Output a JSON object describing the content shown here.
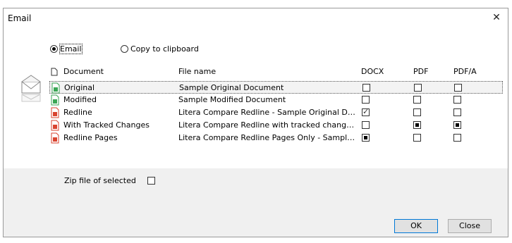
{
  "window": {
    "title": "Email",
    "close_glyph": "✕"
  },
  "mode": {
    "options": [
      {
        "label": "Email",
        "selected": true
      },
      {
        "label": "Copy to clipboard",
        "selected": false
      }
    ]
  },
  "table": {
    "headers": {
      "document": "Document",
      "file_name": "File name",
      "docx": "DOCX",
      "pdf": "PDF",
      "pdfa": "PDF/A"
    },
    "rows": [
      {
        "document": "Original",
        "file_name": "Sample Original Document",
        "docx": "unchecked",
        "pdf": "unchecked",
        "pdfa": "unchecked",
        "selected": true
      },
      {
        "document": "Modified",
        "file_name": "Sample Modified Document",
        "docx": "unchecked",
        "pdf": "unchecked",
        "pdfa": "unchecked",
        "selected": false
      },
      {
        "document": "Redline",
        "file_name": "Litera Compare Redline - Sample Original Docu...",
        "docx": "checked",
        "pdf": "unchecked",
        "pdfa": "unchecked",
        "selected": false
      },
      {
        "document": "With Tracked Changes",
        "file_name": "Litera Compare Redline with tracked changes - S...",
        "docx": "unchecked",
        "pdf": "partial",
        "pdfa": "partial",
        "selected": false
      },
      {
        "document": "Redline Pages",
        "file_name": "Litera Compare Redline Pages Only - Sample Ori...",
        "docx": "partial",
        "pdf": "unchecked",
        "pdfa": "unchecked",
        "selected": false
      }
    ]
  },
  "zip": {
    "label": "Zip file of selected",
    "checked": false
  },
  "buttons": {
    "ok": "OK",
    "close": "Close"
  },
  "colors": {
    "accent": "#0078d7",
    "panel": "#f0f0f0",
    "doc_icon_red": "#d9432f",
    "doc_icon_green": "#3aa655"
  },
  "icons": {
    "email": "envelope-icon",
    "header_doc": "document-icon"
  }
}
